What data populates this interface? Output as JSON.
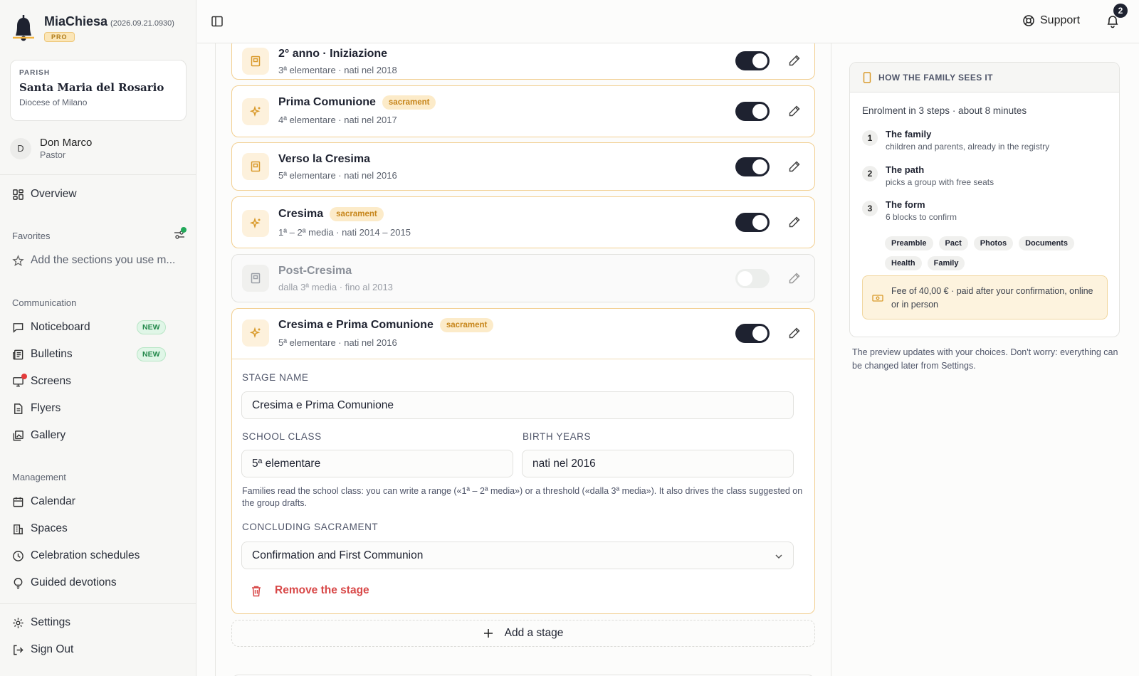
{
  "app": {
    "name": "MiaChiesa",
    "version": "(2026.09.21.0930)",
    "tier": "PRO"
  },
  "parish": {
    "label": "PARISH",
    "name": "Santa Maria del Rosario",
    "diocese": "Diocese of Milano"
  },
  "user": {
    "initial": "D",
    "name": "Don Marco",
    "role": "Pastor"
  },
  "sidebar": {
    "overview": "Overview",
    "favorites_label": "Favorites",
    "favorites_hint": "Add the sections you use m...",
    "communication_label": "Communication",
    "communication": [
      {
        "label": "Noticeboard",
        "badge": "NEW"
      },
      {
        "label": "Bulletins",
        "badge": "NEW"
      },
      {
        "label": "Screens"
      },
      {
        "label": "Flyers"
      },
      {
        "label": "Gallery"
      }
    ],
    "management_label": "Management",
    "management": [
      {
        "label": "Calendar"
      },
      {
        "label": "Spaces"
      },
      {
        "label": "Celebration schedules"
      },
      {
        "label": "Guided devotions"
      }
    ],
    "settings": "Settings",
    "signout": "Sign Out"
  },
  "topbar": {
    "support": "Support",
    "notifications": "2"
  },
  "stages": [
    {
      "title": "2° anno · Iniziazione",
      "sub": "3ª elementare · nati nel 2018",
      "enabled": true,
      "icon": "book-icon"
    },
    {
      "title": "Prima Comunione",
      "badge": "sacrament",
      "sub": "4ª elementare · nati nel 2017",
      "enabled": true,
      "icon": "sparkle-icon"
    },
    {
      "title": "Verso la Cresima",
      "sub": "5ª elementare · nati nel 2016",
      "enabled": true,
      "icon": "book-icon"
    },
    {
      "title": "Cresima",
      "badge": "sacrament",
      "sub": "1ª – 2ª media · nati 2014 – 2015",
      "enabled": true,
      "icon": "sparkle-icon"
    },
    {
      "title": "Post-Cresima",
      "sub": "dalla 3ª media · fino al 2013",
      "enabled": false,
      "icon": "book-icon"
    },
    {
      "title": "Cresima e Prima Comunione",
      "badge": "sacrament",
      "sub": "5ª elementare · nati nel 2016",
      "enabled": true,
      "icon": "sparkle-icon"
    }
  ],
  "editor": {
    "stage_name_label": "STAGE NAME",
    "stage_name": "Cresima e Prima Comunione",
    "school_class_label": "SCHOOL CLASS",
    "school_class": "5ª elementare",
    "birth_years_label": "BIRTH YEARS",
    "birth_years": "nati nel 2016",
    "help": "Families read the school class: you can write a range («1ª – 2ª media») or a threshold («dalla 3ª media»). It also drives the class suggested on the group drafts.",
    "sacrament_label": "CONCLUDING SACRAMENT",
    "sacrament_value": "Confirmation and First Communion",
    "remove": "Remove the stage"
  },
  "add_stage": "Add a stage",
  "preview": {
    "header": "HOW THE FAMILY SEES IT",
    "intro": "Enrolment in 3 steps · about 8 minutes",
    "steps": [
      {
        "num": "1",
        "title": "The family",
        "desc": "children and parents, already in the registry"
      },
      {
        "num": "2",
        "title": "The path",
        "desc": "picks a group with free seats"
      },
      {
        "num": "3",
        "title": "The form",
        "desc": "6 blocks to confirm"
      }
    ],
    "chips": [
      "Preamble",
      "Pact",
      "Photos",
      "Documents",
      "Health",
      "Family"
    ],
    "fee": "Fee of 40,00 € · paid after your confirmation, online or in person",
    "note": "The preview updates with your choices. Don't worry: everything can be changed later from Settings."
  }
}
